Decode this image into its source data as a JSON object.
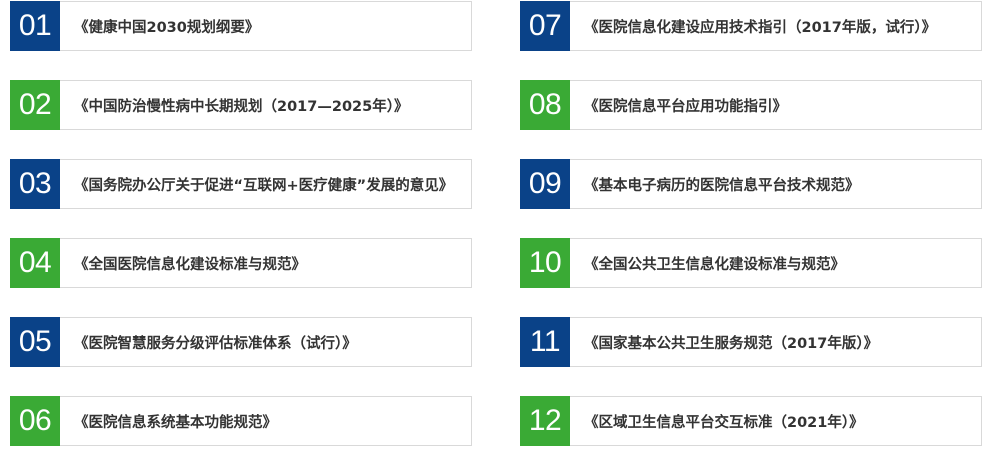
{
  "colors": {
    "blue": "#0a4288",
    "green": "#3aaa35",
    "text": "#333333",
    "border": "#d9d9d9"
  },
  "left_items": [
    {
      "num": "01",
      "color": "blue",
      "title": "《健康中国2030规划纲要》"
    },
    {
      "num": "02",
      "color": "green",
      "title": "《中国防治慢性病中长期规划（2017—2025年）》"
    },
    {
      "num": "03",
      "color": "blue",
      "title": "《国务院办公厅关于促进“互联网+医疗健康”发展的意见》"
    },
    {
      "num": "04",
      "color": "green",
      "title": "《全国医院信息化建设标准与规范》"
    },
    {
      "num": "05",
      "color": "blue",
      "title": "《医院智慧服务分级评估标准体系（试行）》"
    },
    {
      "num": "06",
      "color": "green",
      "title": "《医院信息系统基本功能规范》"
    }
  ],
  "right_items": [
    {
      "num": "07",
      "color": "blue",
      "title": "《医院信息化建设应用技术指引（2017年版，试行）》"
    },
    {
      "num": "08",
      "color": "green",
      "title": "《医院信息平台应用功能指引》"
    },
    {
      "num": "09",
      "color": "blue",
      "title": "《基本电子病历的医院信息平台技术规范》"
    },
    {
      "num": "10",
      "color": "green",
      "title": "《全国公共卫生信息化建设标准与规范》"
    },
    {
      "num": "11",
      "color": "blue",
      "title": "《国家基本公共卫生服务规范（2017年版）》"
    },
    {
      "num": "12",
      "color": "green",
      "title": "《区域卫生信息平台交互标准（2021年）》"
    }
  ]
}
